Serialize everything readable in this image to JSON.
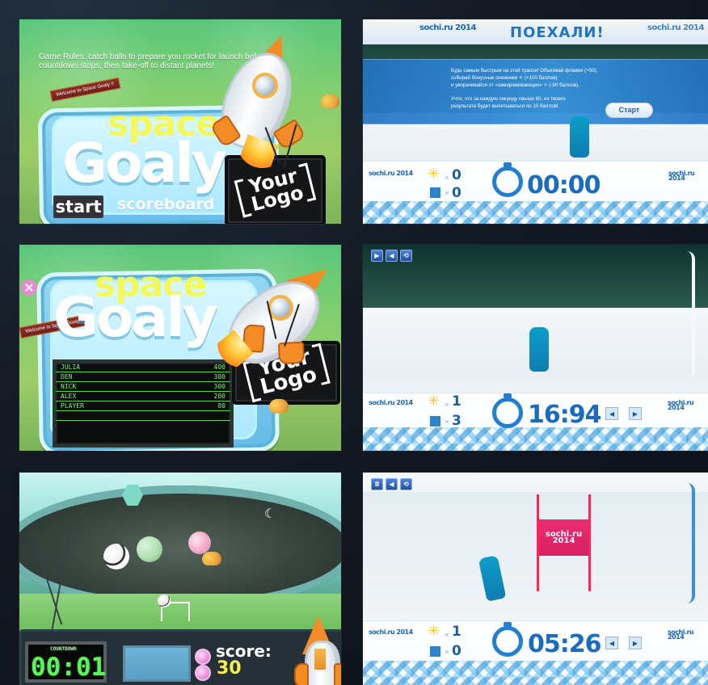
{
  "space_goaly_menu": {
    "rules": "Game Rules: catch balls to prepare you rocket for launch before countdown stops, then take-off to distant planets!",
    "ribbon": "Welcome to Space Goaly !!",
    "space": "space",
    "goaly": "Goaly",
    "start": "start",
    "scoreboard": "scoreboard",
    "your": "Your",
    "logo": "Logo"
  },
  "space_goaly_scoreboard": {
    "ribbon": "Welcome to Space Goaly !!",
    "space": "space",
    "goaly": "Goaly",
    "your": "Your",
    "logo": "Logo",
    "close": "×",
    "scores": [
      {
        "name": "JULIA",
        "value": "400"
      },
      {
        "name": "DEN",
        "value": "380"
      },
      {
        "name": "NICK",
        "value": "300"
      },
      {
        "name": "ALEX",
        "value": "200"
      },
      {
        "name": "PLAYER",
        "value": "80"
      }
    ]
  },
  "space_goaly_gameplay": {
    "countdown_label": "COUNTDOWN",
    "countdown": "00:01",
    "score_label": "score:",
    "score": "30"
  },
  "sochi_start": {
    "header": "ПОЕХАЛИ!",
    "logo_left": "sochi.ru 2014",
    "logo_right": "sochi.ru 2014",
    "banner_line1": "Будь самым быстрым на этой трассе! Объезжай флажки (+50),",
    "banner_line2": "собирай бонусные снежинки",
    "banner_line2b": "(+100 баллов)",
    "banner_line3": "и уворачивайся от «замораживающих»",
    "banner_line3b": "(-50 баллов).",
    "banner_line4": "Учти, что за каждую секунду свыше 60, из твоего",
    "banner_line5": "результата будет вычитываться по 10 баллов!",
    "start_button": "Старт",
    "snowflakes": "0",
    "flags": "0",
    "timer": "00:00"
  },
  "sochi_run_1": {
    "logo_left": "sochi.ru 2014",
    "logo_right": "sochi.ru 2014",
    "snowflakes": "1",
    "flags": "3",
    "timer": "16:94"
  },
  "sochi_run_2": {
    "logo_left": "sochi.ru 2014",
    "logo_right": "sochi.ru 2014",
    "snowflakes": "1",
    "flags": "0",
    "timer": "05:26",
    "gate_logo": "sochi.ru 2014"
  },
  "common": {
    "x": "×",
    "snowflake_icon": "snowflake-icon",
    "flag_icon": "flag-icon",
    "stopwatch_icon": "stopwatch-icon"
  }
}
